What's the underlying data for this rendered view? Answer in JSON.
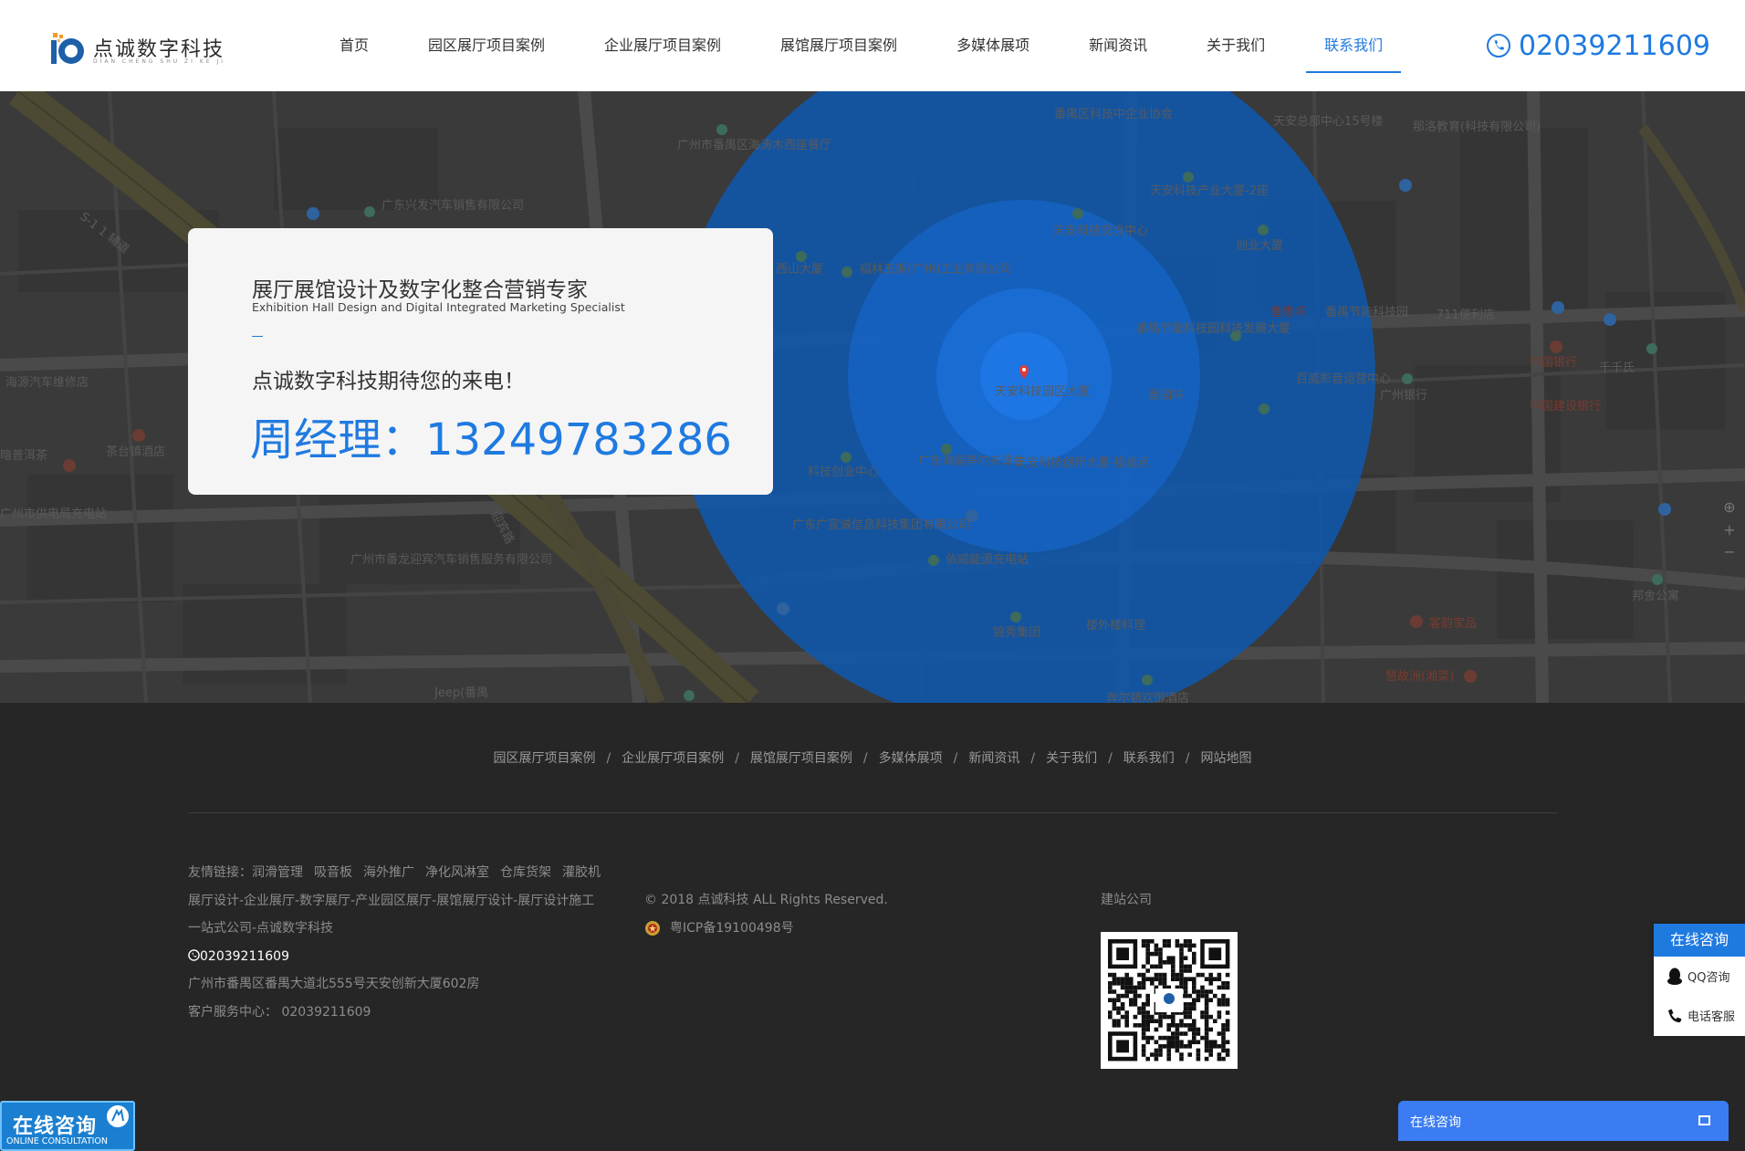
{
  "header": {
    "logo_text": "点诚数字科技",
    "logo_sub": "DIAN CHENG SHU ZI KE JI",
    "nav": [
      {
        "label": "首页",
        "active": false
      },
      {
        "label": "园区展厅项目案例",
        "active": false
      },
      {
        "label": "企业展厅项目案例",
        "active": false
      },
      {
        "label": "展馆展厅项目案例",
        "active": false
      },
      {
        "label": "多媒体展项",
        "active": false
      },
      {
        "label": "新闻资讯",
        "active": false
      },
      {
        "label": "关于我们",
        "active": false
      },
      {
        "label": "联系我们",
        "active": true
      }
    ],
    "hotline": "02039211609"
  },
  "map": {
    "labels": [
      "番禺区科技中企业协会",
      "天安总部中心15号楼",
      "那洛教育(科技有限公司)",
      "广州市番禺区海涛木西座餐厅",
      "广东兴发汽车销售有限公司",
      "天安科技产业大厦-2座",
      "天安科技交流中心",
      "创业大厦",
      "番禺节能科技园科技发展大厦",
      "西山大厦",
      "福林五斯(广州)工业有限公司",
      "香贵将",
      "番禺节能科技园",
      "711便利店",
      "中国银行",
      "千千氏",
      "中国建设银行",
      "海源汽车维修店",
      "茶台镇酒店",
      "暗普洱茶",
      "百威影音运营中心",
      "广州银行",
      "香园味",
      "天安科技园区大厦",
      "广东海鼎亭尔夫球会",
      "天安科技创新大厦-投运点",
      "科技创业中心",
      "广州市供电局充电站",
      "广东广宣诚信息科技集团有限公司",
      "依威能源充电站",
      "广州市番龙迎宾汽车销售服务有限公司",
      "锦秀集团",
      "楼外楼料理",
      "客韵家品",
      "邦舍公寓",
      "慧故洲(湘菜)",
      "Jeep(番禺",
      "奔尔顿欢御酒店",
      "S-1 1 辅道",
      "迎宾路"
    ]
  },
  "card": {
    "title": "展厅展馆设计及数字化整合营销专家",
    "subtitle": "Exhibition Hall Design and Digital Integrated Marketing Specialist",
    "line": "点诚数字科技期待您的来电！",
    "phone": "周经理：13249783286"
  },
  "footer": {
    "nav": [
      "园区展厅项目案例",
      "企业展厅项目案例",
      "展馆展厅项目案例",
      "多媒体展项",
      "新闻资讯",
      "关于我们",
      "联系我们",
      "网站地图"
    ],
    "links_label": "友情链接：",
    "links": [
      "润滑管理",
      "吸音板",
      "海外推广",
      "净化风淋室",
      "仓库货架",
      "灌胶机"
    ],
    "desc_line1": "展厅设计-企业展厅-数字展厅-产业园区展厅-展馆展厅设计-展厅设计施工",
    "desc_line2": "一站式公司-点诚数字科技",
    "phone": "02039211609",
    "address": "广州市番禺区番禺大道北555号天安创新大厦602房",
    "service": "客户服务中心： 02039211609",
    "copyright": "© 2018 点诚科技 ALL Rights Reserved.",
    "icp": "粤ICP备19100498号",
    "site_build": "建站公司"
  },
  "widgets": {
    "side_title": "在线咨询",
    "side_qq": "QQ咨询",
    "side_phone": "电话客服",
    "consult_big": "在线咨询",
    "consult_small": "ONLINE CONSULTATION",
    "chat_label": "在线咨询"
  },
  "colors": {
    "brand_blue": "#1f7ae0",
    "footer_bg": "#262626",
    "map_circle": "#1565c0"
  }
}
